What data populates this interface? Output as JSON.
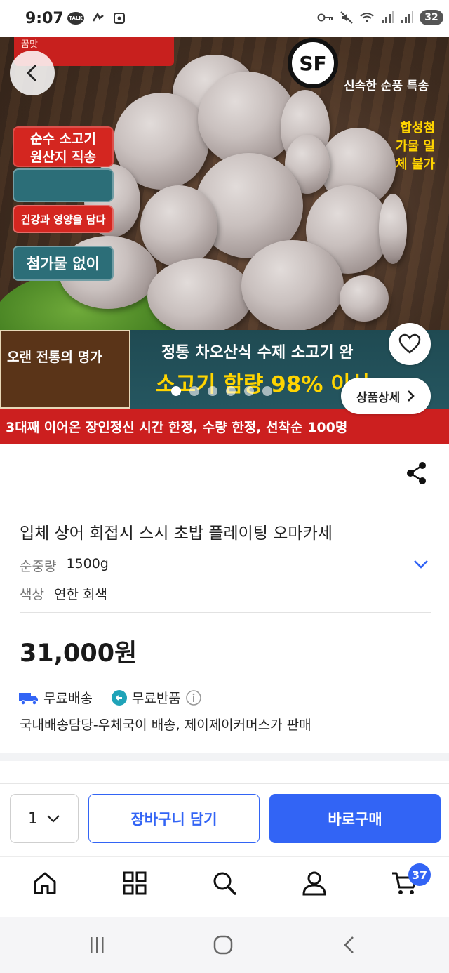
{
  "status_bar": {
    "time": "9:07",
    "talk_label": "TALK",
    "battery": "32"
  },
  "hero": {
    "top_banner": "꿈맛",
    "sf_logo": "SF",
    "sf_text": "신속한 순풍 특송",
    "badge_1": "순수 소고기\n원산지 직송",
    "badge_2": "건강과 영양을 담다",
    "badge_3": "첨가물 없이",
    "side_text": [
      "합성첨",
      "가물 일",
      "체 불가"
    ],
    "bottom_left": "오랜 전통의 명가",
    "band_line1": "정통 차오산식 수제 소고기 완",
    "band_line2": "소고기 함량 98% 이상",
    "red_strip": "3대째 이어온 장인정신 시간 한정, 수량 한정, 선착순 100명",
    "detail_button": "상품상세",
    "carousel": {
      "count": 6,
      "active": 0
    }
  },
  "product": {
    "title": "입체 상어 회접시 스시 초밥 플레이팅 오마카세",
    "options": [
      {
        "label": "순중량",
        "value": "1500g"
      },
      {
        "label": "색상",
        "value": "연한 회색"
      }
    ],
    "price": "31,000원",
    "shipping_free": "무료배송",
    "return_free": "무료반품",
    "seller_info": "국내배송담당-우체국이 배송, 제이제이커머스가 판매"
  },
  "purchase": {
    "quantity": "1",
    "cart_label": "장바구니 담기",
    "buy_label": "바로구매"
  },
  "bottom_nav": {
    "cart_count": "37"
  },
  "colors": {
    "primary": "#3264f5",
    "banner_red": "#cc1f1f",
    "banner_teal": "#2c6e78",
    "banner_yellow": "#ffd400"
  }
}
